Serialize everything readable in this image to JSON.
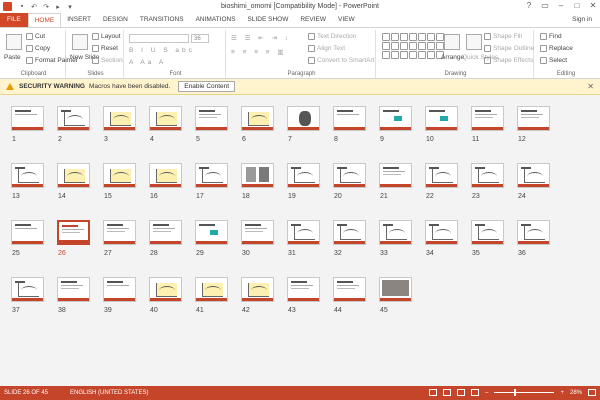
{
  "window": {
    "title": "bioshimi_omomi [Compatibility Mode] - PowerPoint",
    "qat": [
      "save-icon",
      "undo-icon",
      "redo-icon",
      "start-icon",
      "customize-icon"
    ],
    "controls": [
      "?",
      "▭",
      "–",
      "□",
      "✕"
    ]
  },
  "tabs": [
    "FILE",
    "HOME",
    "INSERT",
    "DESIGN",
    "TRANSITIONS",
    "ANIMATIONS",
    "SLIDE SHOW",
    "REVIEW",
    "VIEW"
  ],
  "active_tab": "HOME",
  "signin": "Sign in",
  "ribbon": {
    "clipboard": {
      "label": "Clipboard",
      "paste": "Paste",
      "cut": "Cut",
      "copy": "Copy",
      "format_painter": "Format Painter"
    },
    "slides": {
      "label": "Slides",
      "new_slide": "New Slide",
      "layout": "Layout",
      "reset": "Reset",
      "section": "Section"
    },
    "font": {
      "label": "Font",
      "size": "36"
    },
    "paragraph": {
      "label": "Paragraph",
      "text_direction": "Text Direction",
      "align_text": "Align Text",
      "convert": "Convert to SmartArt"
    },
    "drawing": {
      "label": "Drawing",
      "arrange": "Arrange",
      "quick_styles": "Quick Styles",
      "shape_fill": "Shape Fill",
      "shape_outline": "Shape Outline",
      "shape_effects": "Shape Effects"
    },
    "editing": {
      "label": "Editing",
      "find": "Find",
      "replace": "Replace",
      "select": "Select"
    }
  },
  "security": {
    "title": "SECURITY WARNING",
    "message": "Macros have been disabled.",
    "button": "Enable Content"
  },
  "slides": [
    {
      "n": "1",
      "kind": "title"
    },
    {
      "n": "2",
      "kind": "figure"
    },
    {
      "n": "3",
      "kind": "chart-yellow"
    },
    {
      "n": "4",
      "kind": "chart-yellow"
    },
    {
      "n": "5",
      "kind": "text"
    },
    {
      "n": "6",
      "kind": "chart-yellow"
    },
    {
      "n": "7",
      "kind": "molecule"
    },
    {
      "n": "8",
      "kind": "title"
    },
    {
      "n": "9",
      "kind": "teal"
    },
    {
      "n": "10",
      "kind": "teal"
    },
    {
      "n": "11",
      "kind": "text"
    },
    {
      "n": "12",
      "kind": "text"
    },
    {
      "n": "13",
      "kind": "figure"
    },
    {
      "n": "14",
      "kind": "chart-yellow"
    },
    {
      "n": "15",
      "kind": "chart-yellow"
    },
    {
      "n": "16",
      "kind": "chart-yellow"
    },
    {
      "n": "17",
      "kind": "figure"
    },
    {
      "n": "18",
      "kind": "photos"
    },
    {
      "n": "19",
      "kind": "figure"
    },
    {
      "n": "20",
      "kind": "figure"
    },
    {
      "n": "21",
      "kind": "text"
    },
    {
      "n": "22",
      "kind": "figure"
    },
    {
      "n": "23",
      "kind": "figure"
    },
    {
      "n": "24",
      "kind": "figure"
    },
    {
      "n": "25",
      "kind": "title"
    },
    {
      "n": "26",
      "kind": "selected"
    },
    {
      "n": "27",
      "kind": "text"
    },
    {
      "n": "28",
      "kind": "text"
    },
    {
      "n": "29",
      "kind": "teal"
    },
    {
      "n": "30",
      "kind": "text"
    },
    {
      "n": "31",
      "kind": "figure"
    },
    {
      "n": "32",
      "kind": "figure"
    },
    {
      "n": "33",
      "kind": "figure"
    },
    {
      "n": "34",
      "kind": "figure"
    },
    {
      "n": "35",
      "kind": "figure"
    },
    {
      "n": "36",
      "kind": "figure"
    },
    {
      "n": "37",
      "kind": "figure"
    },
    {
      "n": "38",
      "kind": "text"
    },
    {
      "n": "39",
      "kind": "title"
    },
    {
      "n": "40",
      "kind": "chart-yellow"
    },
    {
      "n": "41",
      "kind": "chart-yellow"
    },
    {
      "n": "42",
      "kind": "chart-yellow"
    },
    {
      "n": "43",
      "kind": "text"
    },
    {
      "n": "44",
      "kind": "text"
    },
    {
      "n": "45",
      "kind": "picture"
    }
  ],
  "selected_slide": "26",
  "status": {
    "slide": "SLIDE 26 OF 45",
    "language": "ENGLISH (UNITED STATES)",
    "zoom": "28%"
  },
  "colors": {
    "accent": "#C5452A",
    "file_tab": "#D24726",
    "warning_bg": "#FFF4CE"
  }
}
